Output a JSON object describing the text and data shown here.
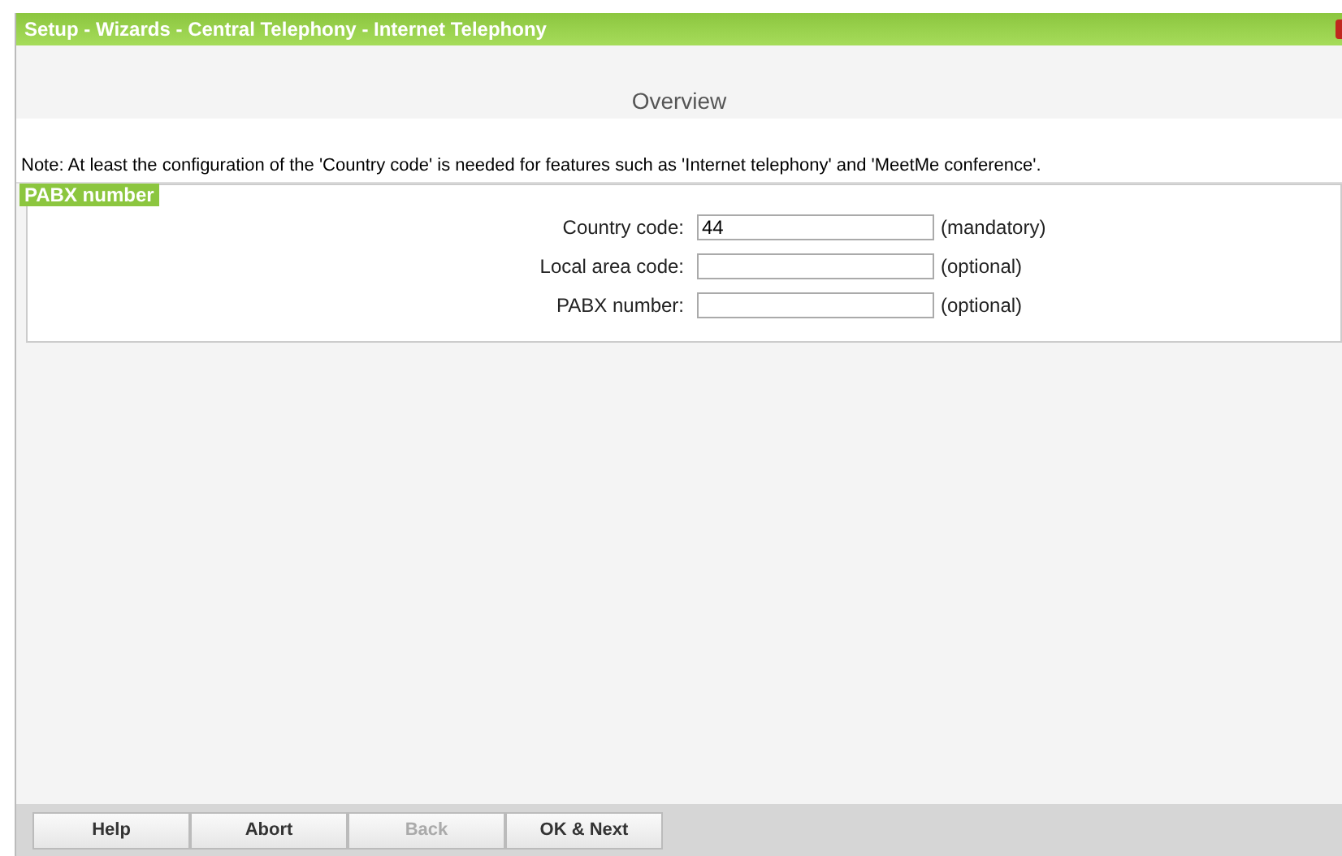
{
  "window": {
    "title": "Setup - Wizards - Central Telephony - Internet Telephony"
  },
  "heading": "Overview",
  "note": "Note: At least the configuration of the 'Country code' is needed for features such as 'Internet telephony' and 'MeetMe conference'.",
  "section": {
    "title": "PABX number",
    "fields": [
      {
        "label": "Country code:",
        "value": "44",
        "hint": "(mandatory)"
      },
      {
        "label": "Local area code:",
        "hint": "(optional)"
      },
      {
        "label": "PABX number:",
        "hint": "(optional)"
      }
    ]
  },
  "buttons": [
    {
      "label": "Help",
      "disabled": false
    },
    {
      "label": "Abort",
      "disabled": false
    },
    {
      "label": "Back",
      "disabled": true
    },
    {
      "label": "OK & Next",
      "disabled": false
    }
  ]
}
